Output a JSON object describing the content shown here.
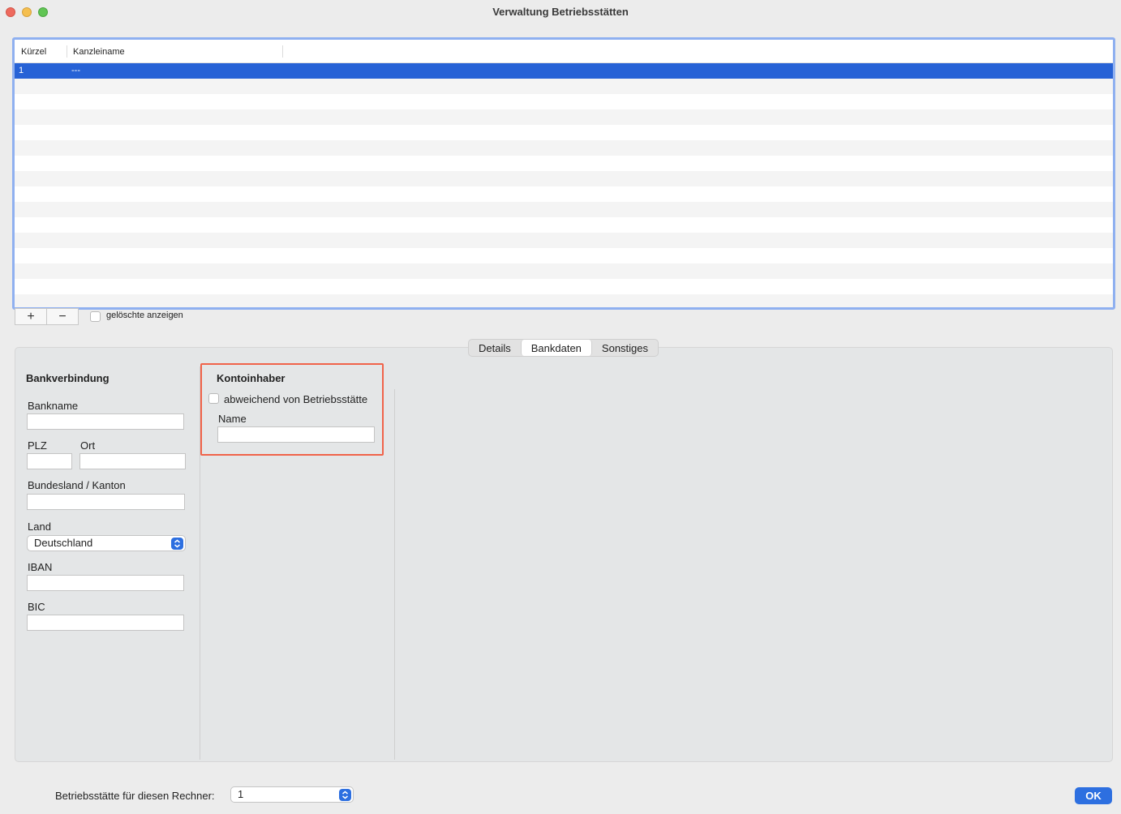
{
  "window": {
    "title": "Verwaltung Betriebsstätten"
  },
  "table": {
    "columns": [
      "Kürzel",
      "Kanzleiname"
    ],
    "rows": [
      {
        "kuerzel": "1",
        "kanzleiname": "---",
        "selected": true
      }
    ]
  },
  "list_controls": {
    "add_label": "+",
    "remove_label": "−",
    "show_deleted_label": "gelöschte anzeigen",
    "show_deleted_checked": false
  },
  "tabs": [
    {
      "label": "Details",
      "active": false
    },
    {
      "label": "Bankdaten",
      "active": true
    },
    {
      "label": "Sonstiges",
      "active": false
    }
  ],
  "bankverbindung": {
    "heading": "Bankverbindung",
    "bankname_label": "Bankname",
    "bankname_value": "",
    "plz_label": "PLZ",
    "plz_value": "",
    "ort_label": "Ort",
    "ort_value": "",
    "bundesland_label": "Bundesland / Kanton",
    "bundesland_value": "",
    "land_label": "Land",
    "land_value": "Deutschland",
    "iban_label": "IBAN",
    "iban_value": "",
    "bic_label": "BIC",
    "bic_value": ""
  },
  "kontoinhaber": {
    "heading": "Kontoinhaber",
    "abweichend_label": "abweichend von Betriebsstätte",
    "abweichend_checked": false,
    "name_label": "Name",
    "name_value": ""
  },
  "footer": {
    "rechner_label": "Betriebsstätte für diesen Rechner:",
    "rechner_value": "1",
    "ok_label": "OK"
  },
  "colors": {
    "selection": "#2762d6",
    "accent": "#2d6fe0",
    "highlight_border": "#f0634a"
  }
}
